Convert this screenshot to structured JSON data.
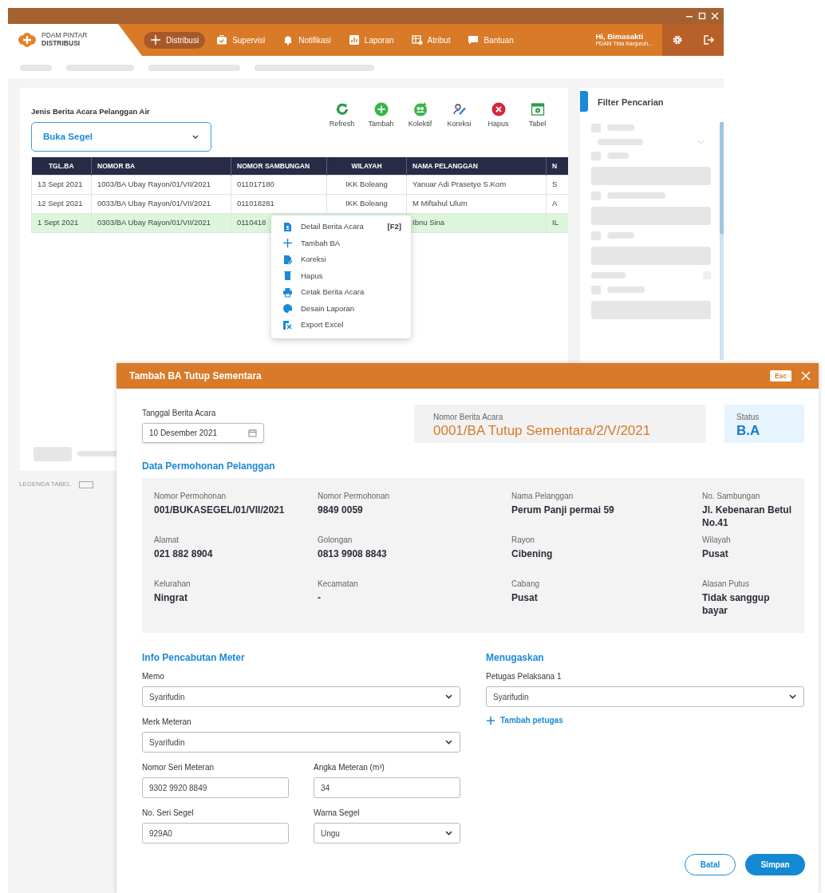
{
  "app": {
    "logo": {
      "line1": "PDAM PINTAR",
      "line2": "DISTRIBUSI"
    },
    "nav": [
      {
        "label": "Distribusi",
        "selected": true
      },
      {
        "label": "Supervisi",
        "selected": false
      },
      {
        "label": "Notifikasi",
        "selected": false
      },
      {
        "label": "Laporan",
        "selected": false
      },
      {
        "label": "Atribut",
        "selected": false
      },
      {
        "label": "Bantuan",
        "selected": false
      }
    ],
    "user": {
      "name": "Hi, Bimasakti",
      "org": "PDAM Tirta Kanjuruh..."
    }
  },
  "panel": {
    "label": "Jenis Berita Acara Pelanggan Air",
    "select": "Buka Segel",
    "toolbar": [
      "Refresh",
      "Tambah",
      "Kolektif",
      "Koreksi",
      "Hapus",
      "Tabel"
    ],
    "table": {
      "columns": [
        "TGL.BA",
        "NOMOR BA",
        "NOMOR SAMBUNGAN",
        "WILAYAH",
        "NAMA PELANGGAN",
        "N"
      ],
      "rows": [
        {
          "cells": [
            "13 Sept 2021",
            "1003/BA Ubay Rayon/01/VII/2021",
            "011017180",
            "IKK Boleang",
            "Yanuar Adi Prasetyo S.Kom",
            "S"
          ],
          "selected": false
        },
        {
          "cells": [
            "12 Sept 2021",
            "0033/BA Ubay Rayon/01/VII/2021",
            "011018281",
            "IKK Boleang",
            "M Miftahul Ulum",
            "A"
          ],
          "selected": false
        },
        {
          "cells": [
            "1 Sept 2021",
            "0303/BA Ubay Rayon/01/VII/2021",
            "0110418",
            "",
            "Ibnu Sina",
            "IL"
          ],
          "selected": true
        }
      ]
    },
    "legend": "LEGENDA TABEL"
  },
  "context_menu": [
    {
      "label": "Detail Berita Acara",
      "shortcut": "[F2]"
    },
    {
      "label": "Tambah BA"
    },
    {
      "label": "Koreksi"
    },
    {
      "label": "Hapus"
    },
    {
      "label": "Cetak Berita Acara"
    },
    {
      "label": "Desain Laporan"
    },
    {
      "label": "Export Excel"
    }
  ],
  "filter": {
    "title": "Filter Pencarian"
  },
  "modal": {
    "title": "Tambah BA Tutup Sementara",
    "esc": "Esc",
    "date": {
      "label": "Tanggal Berita Acara",
      "value": "10 Desember 2021"
    },
    "number": {
      "label": "Nomor Berita Acara",
      "value": "0001/BA Tutup Sementara/2/V/2021"
    },
    "status": {
      "label": "Status",
      "value": "B.A"
    },
    "section": "Data Permohonan Pelanggan",
    "details": [
      {
        "label": "Nomor Permohonan",
        "value": "001/BUKASEGEL/01/VII/2021"
      },
      {
        "label": "Nomor Permohonan",
        "value": "9849 0059"
      },
      {
        "label": "Nama Pelanggan",
        "value": "Perum Panji permai 59"
      },
      {
        "label": "No. Sambungan",
        "value": "Jl. Kebenaran Betul No.41"
      },
      {
        "label": "Alamat",
        "value": "021 882 8904"
      },
      {
        "label": "Golongan",
        "value": "0813 9908 8843"
      },
      {
        "label": "Rayon",
        "value": "Cibening"
      },
      {
        "label": "Wilayah",
        "value": "Pusat"
      },
      {
        "label": "Kelurahan",
        "value": "Ningrat"
      },
      {
        "label": "Kecamatan",
        "value": "-"
      },
      {
        "label": "Cabang",
        "value": "Pusat"
      },
      {
        "label": "Alasan Putus",
        "value": "Tidak sanggup bayar"
      }
    ],
    "meter_section": "Info Pencabutan Meter",
    "meter_fields": [
      {
        "label": "Memo",
        "value": "Syarifudin",
        "kind": "select"
      },
      {
        "label": "Merk Meteran",
        "value": "Syarifudin",
        "kind": "select"
      },
      {
        "label": "Nomor Seri Meteran",
        "value": "9302 9920 8849",
        "kind": "input"
      },
      {
        "label": "Angka Meteran (m³)",
        "value": "34",
        "kind": "input"
      },
      {
        "label": "No. Seri Segel",
        "value": "929A0",
        "kind": "input"
      },
      {
        "label": "Warna Segel",
        "value": "Ungu",
        "kind": "select"
      }
    ],
    "assign_section": "Menugaskan",
    "assign_fields": [
      {
        "label": "Petugas Pelaksana 1",
        "value": "Syarifudin",
        "kind": "select"
      }
    ],
    "add_link": "Tambah petugas",
    "buttons": [
      {
        "label": "Batal",
        "kind": "outline"
      },
      {
        "label": "Simpan",
        "kind": "primary"
      }
    ]
  }
}
